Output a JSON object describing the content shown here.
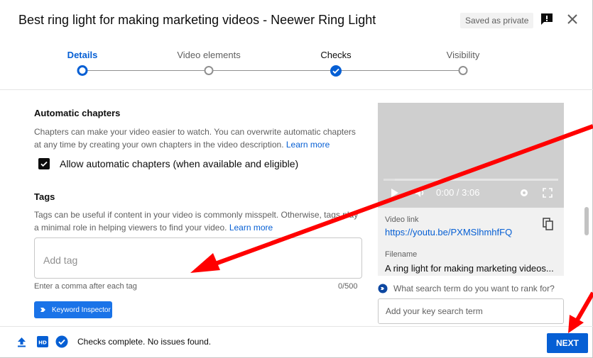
{
  "header": {
    "title": "Best ring light for making marketing videos - Neewer Ring Light",
    "saved_badge": "Saved as private"
  },
  "stepper": {
    "steps": [
      {
        "label": "Details",
        "state": "active"
      },
      {
        "label": "Video elements",
        "state": "todo"
      },
      {
        "label": "Checks",
        "state": "done"
      },
      {
        "label": "Visibility",
        "state": "todo"
      }
    ]
  },
  "chapters": {
    "heading": "Automatic chapters",
    "description": "Chapters can make your video easier to watch. You can overwrite automatic chapters at any time by creating your own chapters in the video description.",
    "learn_more": "Learn more",
    "checkbox_label": "Allow automatic chapters (when available and eligible)",
    "checked": true
  },
  "tags": {
    "heading": "Tags",
    "description": "Tags can be useful if content in your video is commonly misspelt. Otherwise, tags play a minimal role in helping viewers to find your video.",
    "learn_more": "Learn more",
    "placeholder": "Add tag",
    "hint": "Enter a comma after each tag",
    "count": "0/500",
    "keyword_button": "Keyword Inspector"
  },
  "player": {
    "time": "0:00 / 3:06"
  },
  "video_info": {
    "link_label": "Video link",
    "link": "https://youtu.be/PXMSlhmhfFQ",
    "filename_label": "Filename",
    "filename": "A ring light for making marketing videos..."
  },
  "rank": {
    "question": "What search term do you want to rank for?",
    "placeholder": "Add your key search term"
  },
  "footer": {
    "status": "Checks complete. No issues found.",
    "next_label": "NEXT"
  },
  "colors": {
    "accent": "#065fd4",
    "annotation_arrow": "#ff0000"
  }
}
